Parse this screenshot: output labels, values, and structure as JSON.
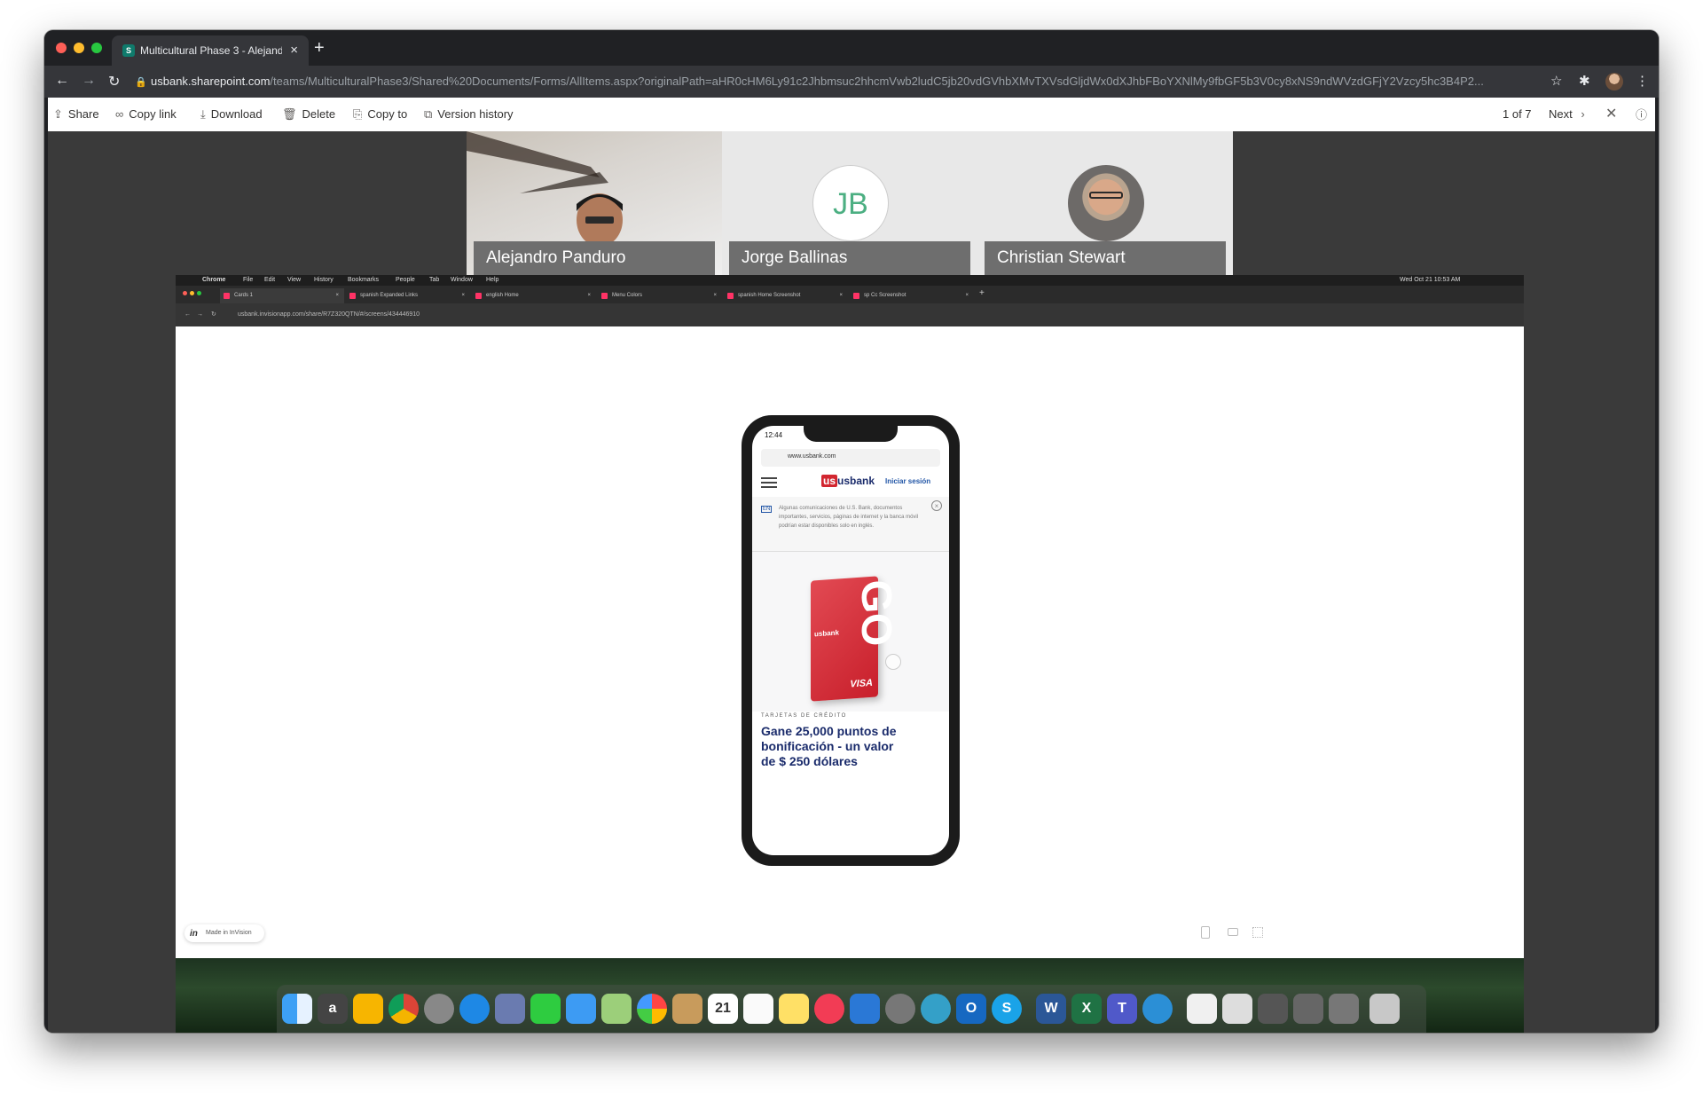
{
  "browser": {
    "tab_title": "Multicultural Phase 3 - Alejand",
    "tab_favicon": "S",
    "url_host": "usbank.sharepoint.com",
    "url_path": "/teams/MulticulturalPhase3/Shared%20Documents/Forms/AllItems.aspx?originalPath=aHR0cHM6Ly91c2Jhbmsuc2hhcmVwb2ludC5jb20vdGVhbXMvTXVsdGljdWx0dXJhbFBoYXNlMy9fbGF5b3V0cy8xNS9ndWVzdGFjY2Vzcy5hc3B4P2..."
  },
  "sharepoint": {
    "share": "Share",
    "copy_link": "Copy link",
    "download": "Download",
    "delete": "Delete",
    "copy_to": "Copy to",
    "version_history": "Version history",
    "page_count": "1 of 7",
    "next": "Next"
  },
  "participants": [
    {
      "name": "Alejandro Panduro"
    },
    {
      "name": "Jorge Ballinas",
      "initials": "JB"
    },
    {
      "name": "Christian Stewart"
    }
  ],
  "shared_screen": {
    "menu": [
      "Chrome",
      "File",
      "Edit",
      "View",
      "History",
      "Bookmarks",
      "People",
      "Tab",
      "Window",
      "Help"
    ],
    "menu_status": "Wed Oct 21  10:53 AM",
    "tabs": [
      "Cards 1",
      "spanish Expanded Links",
      "english Home",
      "Menu Colors",
      "spanish Home Screenshot",
      "sp Cc Screenshot"
    ],
    "url": "usbank.invisionapp.com/share/R7Z320QTN/#/screens/434446910",
    "made_in": "Made in InVision"
  },
  "phone": {
    "time": "12:44",
    "url": "www.usbank.com",
    "brand": "usbank",
    "login": "Iniciar sesión",
    "notice": "Algunas comunicaciones de U.S. Bank, documentos importantes, servicios, páginas de internet y la banca móvil podrían estar disponibles solo en inglés.",
    "category": "TARJETAS DE CRÉDITO",
    "headline": "Gane 25,000 puntos de bonificación - un valor de $ 250 dólares",
    "card_brand": "usbank",
    "card_network": "VISA",
    "card_word": "GO"
  },
  "colors": {
    "usbank_red": "#d22630",
    "headline_navy": "#1a2b6b",
    "link_blue": "#2155a6"
  }
}
